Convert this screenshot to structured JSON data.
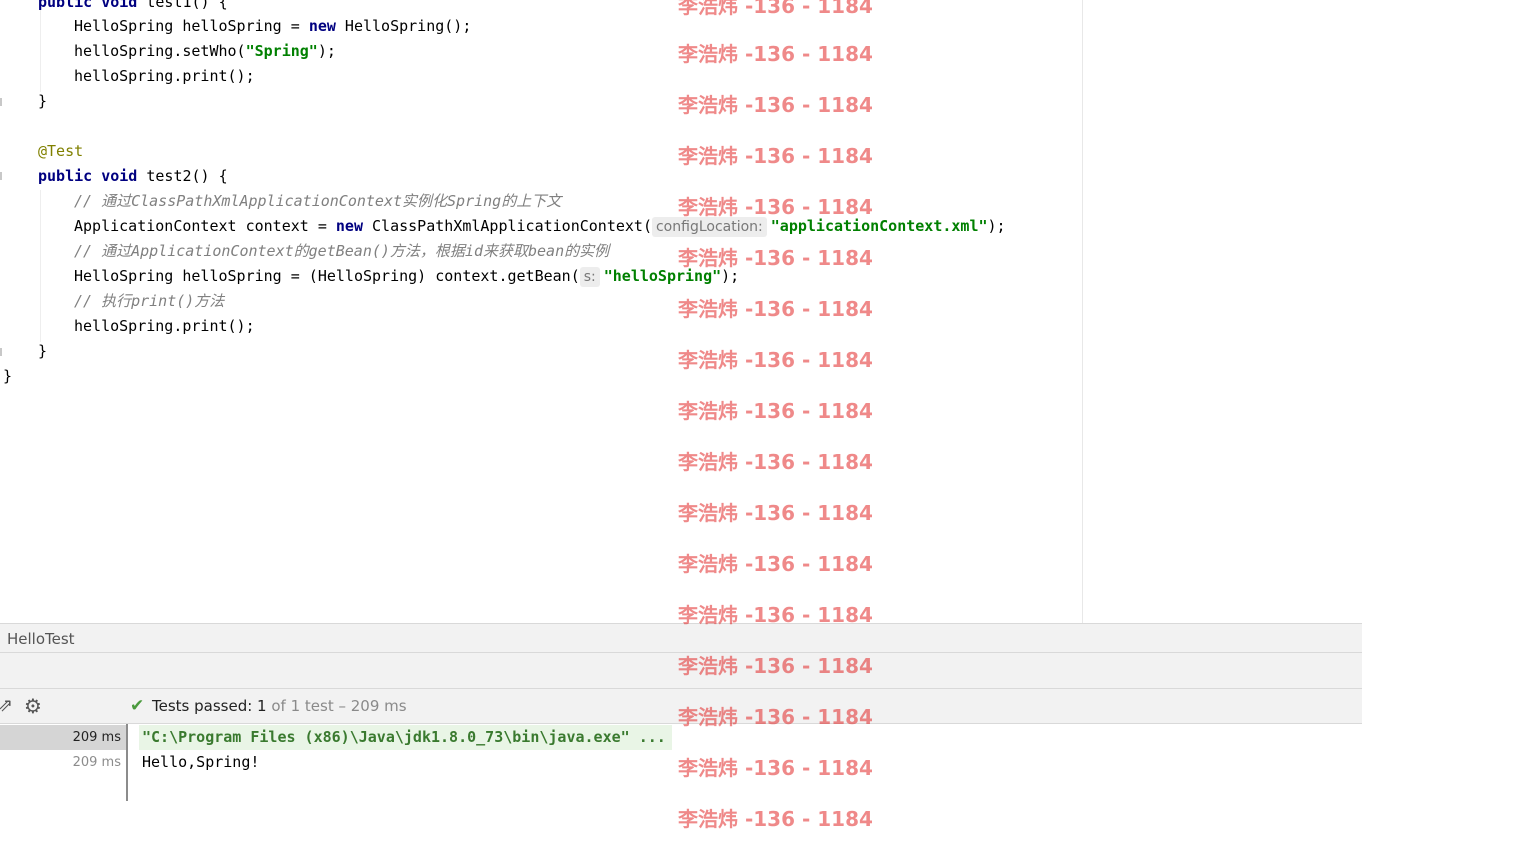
{
  "editor": {
    "lines": [
      {
        "t1": "public void test1() {"
      },
      {
        "a": "HelloSpring helloSpring = ",
        "kw": "new",
        "b": " HelloSpring();"
      },
      {
        "a": "helloSpring.setWho(",
        "str": "\"Spring\"",
        "b": ");"
      },
      {
        "a": "helloSpring.print();"
      },
      {
        "a": "}"
      },
      {
        "ann": "@Test"
      },
      {
        "kw1": "public",
        "kw2": "void",
        "b": " test2() {"
      },
      {
        "cmt": "// 通过ClassPathXmlApplicationContext实例化Spring的上下文"
      },
      {
        "a": "ApplicationContext context = ",
        "kw": "new",
        "b": " ClassPathXmlApplicationContext(",
        "hint": "configLocation:",
        "str": "\"applicationContext.xml\"",
        "c": ");"
      },
      {
        "cmt": "// 通过ApplicationContext的getBean()方法，根据id来获取bean的实例"
      },
      {
        "a": "HelloSpring helloSpring = (HelloSpring) context.getBean(",
        "hint": "s:",
        "str": "\"helloSpring\"",
        "c": ");"
      },
      {
        "cmt": "// 执行print()方法"
      },
      {
        "a": "helloSpring.print();"
      },
      {
        "a": "}"
      },
      {
        "a": "}"
      }
    ],
    "line1_kw1": "public",
    "line1_kw2": "void",
    "line1_rest": " test1() {"
  },
  "run_panel": {
    "title": "HelloTest",
    "status_prefix": "Tests passed: ",
    "status_count": "1",
    "status_rest": " of 1 test – 209 ms",
    "tree": [
      {
        "label": "209 ms"
      },
      {
        "label": "209 ms"
      }
    ],
    "console": [
      "\"C:\\Program Files (x86)\\Java\\jdk1.8.0_73\\bin\\java.exe\" ...",
      "Hello,Spring!"
    ]
  },
  "watermark": {
    "text": "李浩炜 -136 - 1184"
  },
  "colors": {
    "keyword": "#000080",
    "string": "#008000",
    "annotation": "#808000",
    "comment": "#808080",
    "pass": "#4a9a3d",
    "watermark": "#e12828"
  }
}
